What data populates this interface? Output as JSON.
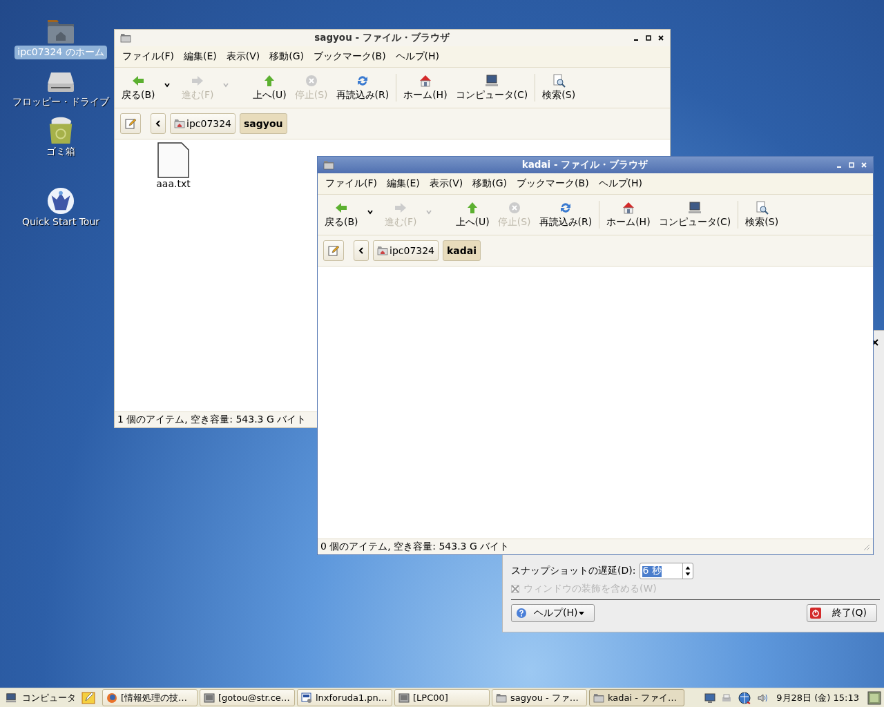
{
  "desktop_icons": [
    {
      "label": "ipc07324 のホーム",
      "kind": "home",
      "selected": true
    },
    {
      "label": "フロッピー・ドライブ",
      "kind": "floppy",
      "selected": false
    },
    {
      "label": "ゴミ箱",
      "kind": "trash",
      "selected": false
    },
    {
      "label": "Quick Start Tour",
      "kind": "tour",
      "selected": false
    }
  ],
  "windows": [
    {
      "title": "sagyou - ファイル・ブラウザ",
      "active": false,
      "menu": [
        "ファイル(F)",
        "編集(E)",
        "表示(V)",
        "移動(G)",
        "ブックマーク(B)",
        "ヘルプ(H)"
      ],
      "toolbar": [
        {
          "kind": "back",
          "label": "戻る(B)",
          "disabled": false,
          "dropdown": true
        },
        {
          "kind": "forward",
          "label": "進む(F)",
          "disabled": true,
          "dropdown": true
        },
        {
          "kind": "up",
          "label": "上へ(U)",
          "disabled": false,
          "dropdown": false
        },
        {
          "kind": "stop",
          "label": "停止(S)",
          "disabled": true,
          "dropdown": false
        },
        {
          "kind": "reload",
          "label": "再読込み(R)",
          "disabled": false,
          "dropdown": false
        },
        {
          "kind": "separator"
        },
        {
          "kind": "home",
          "label": "ホーム(H)",
          "disabled": false,
          "dropdown": false
        },
        {
          "kind": "computer",
          "label": "コンピュータ(C)",
          "disabled": false,
          "dropdown": false
        },
        {
          "kind": "separator"
        },
        {
          "kind": "search",
          "label": "検索(S)",
          "disabled": false,
          "dropdown": false
        }
      ],
      "path": [
        {
          "label": "ipc07324",
          "kind": "home",
          "selected": false
        },
        {
          "label": "sagyou",
          "kind": "folder",
          "selected": true
        }
      ],
      "files": [
        {
          "name": "aaa.txt"
        }
      ],
      "status": "1 個のアイテム, 空き容量: 543.3 G バイト"
    },
    {
      "title": "kadai - ファイル・ブラウザ",
      "active": true,
      "menu": [
        "ファイル(F)",
        "編集(E)",
        "表示(V)",
        "移動(G)",
        "ブックマーク(B)",
        "ヘルプ(H)"
      ],
      "toolbar": [
        {
          "kind": "back",
          "label": "戻る(B)",
          "disabled": false,
          "dropdown": true
        },
        {
          "kind": "forward",
          "label": "進む(F)",
          "disabled": true,
          "dropdown": true
        },
        {
          "kind": "up",
          "label": "上へ(U)",
          "disabled": false,
          "dropdown": false
        },
        {
          "kind": "stop",
          "label": "停止(S)",
          "disabled": true,
          "dropdown": false
        },
        {
          "kind": "reload",
          "label": "再読込み(R)",
          "disabled": false,
          "dropdown": false
        },
        {
          "kind": "separator"
        },
        {
          "kind": "home",
          "label": "ホーム(H)",
          "disabled": false,
          "dropdown": false
        },
        {
          "kind": "computer",
          "label": "コンピュータ(C)",
          "disabled": false,
          "dropdown": false
        },
        {
          "kind": "separator"
        },
        {
          "kind": "search",
          "label": "検索(S)",
          "disabled": false,
          "dropdown": false
        }
      ],
      "path": [
        {
          "label": "ipc07324",
          "kind": "home",
          "selected": false
        },
        {
          "label": "kadai",
          "kind": "folder",
          "selected": true
        }
      ],
      "status": "0 個のアイテム, 空き容量: 543.3 G バイト"
    }
  ],
  "screenshot_dialog": {
    "delay_label": "スナップショットの遅延(D):",
    "delay_value": "6 秒",
    "include_border": {
      "label": "ウィンドウの装飾を含める(W)",
      "checked": true,
      "disabled": true
    },
    "buttons": [
      {
        "label": "ヘルプ(H)",
        "kind": "help"
      },
      {
        "label": "終了(Q)",
        "kind": "quit"
      }
    ]
  },
  "taskbar": {
    "menu": "コンピュータ",
    "tasks": [
      {
        "label": "[情報処理の技…",
        "kind": "browser",
        "selected": false
      },
      {
        "label": "[gotou@str.ce…",
        "kind": "terminal",
        "selected": false
      },
      {
        "label": "lnxforuda1.pn…",
        "kind": "image",
        "selected": false
      },
      {
        "label": "[LPC00]",
        "kind": "terminal",
        "selected": false
      },
      {
        "label": "sagyou - ファ…",
        "kind": "folder",
        "selected": false
      },
      {
        "label": "kadai - ファイ…",
        "kind": "folder",
        "selected": true
      }
    ],
    "clock": "9月28日 (金) 15:13"
  }
}
